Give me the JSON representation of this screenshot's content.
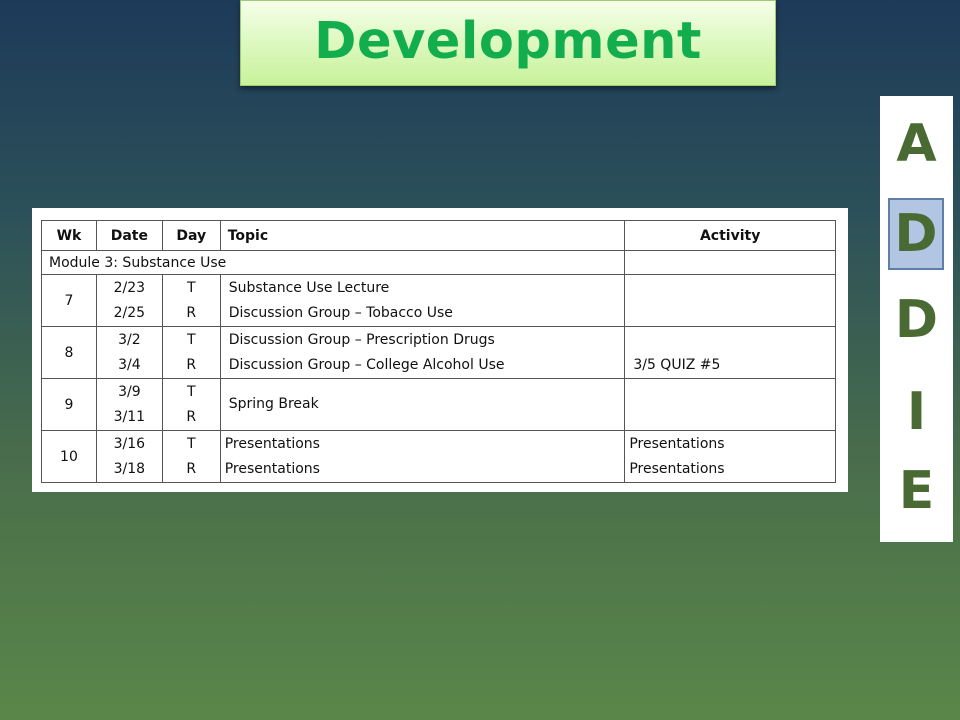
{
  "slide": {
    "title": "Development"
  },
  "addie": {
    "letters": [
      "A",
      "D",
      "D",
      "I",
      "E"
    ],
    "active_index": 1,
    "letter_color": "#4a6a33",
    "highlight_color": "#b2c5e3"
  },
  "schedule": {
    "headers": {
      "wk": "Wk",
      "date": "Date",
      "day": "Day",
      "topic": "Topic",
      "activity": "Activity"
    },
    "module": "Module 3: Substance Use",
    "weeks": [
      {
        "wk": "7",
        "dates": [
          "2/23",
          "2/25"
        ],
        "days": [
          "T",
          "R"
        ],
        "topics": [
          "Substance Use Lecture",
          "Discussion Group – Tobacco Use"
        ],
        "activities": [
          "",
          ""
        ]
      },
      {
        "wk": "8",
        "dates": [
          "3/2",
          "3/4"
        ],
        "days": [
          "T",
          "R"
        ],
        "topics": [
          "Discussion Group – Prescription Drugs",
          "Discussion Group – College Alcohol Use"
        ],
        "activities": [
          "",
          "3/5 QUIZ #5"
        ]
      },
      {
        "wk": "9",
        "dates": [
          "3/9",
          "3/11"
        ],
        "days": [
          "T",
          "R"
        ],
        "topics": [
          "Spring Break"
        ],
        "activities": [
          ""
        ]
      },
      {
        "wk": "10",
        "dates": [
          "3/16",
          "3/18"
        ],
        "days": [
          "T",
          "R"
        ],
        "topics": [
          "Presentations",
          "Presentations"
        ],
        "activities": [
          "Presentations",
          "Presentations"
        ]
      }
    ]
  }
}
